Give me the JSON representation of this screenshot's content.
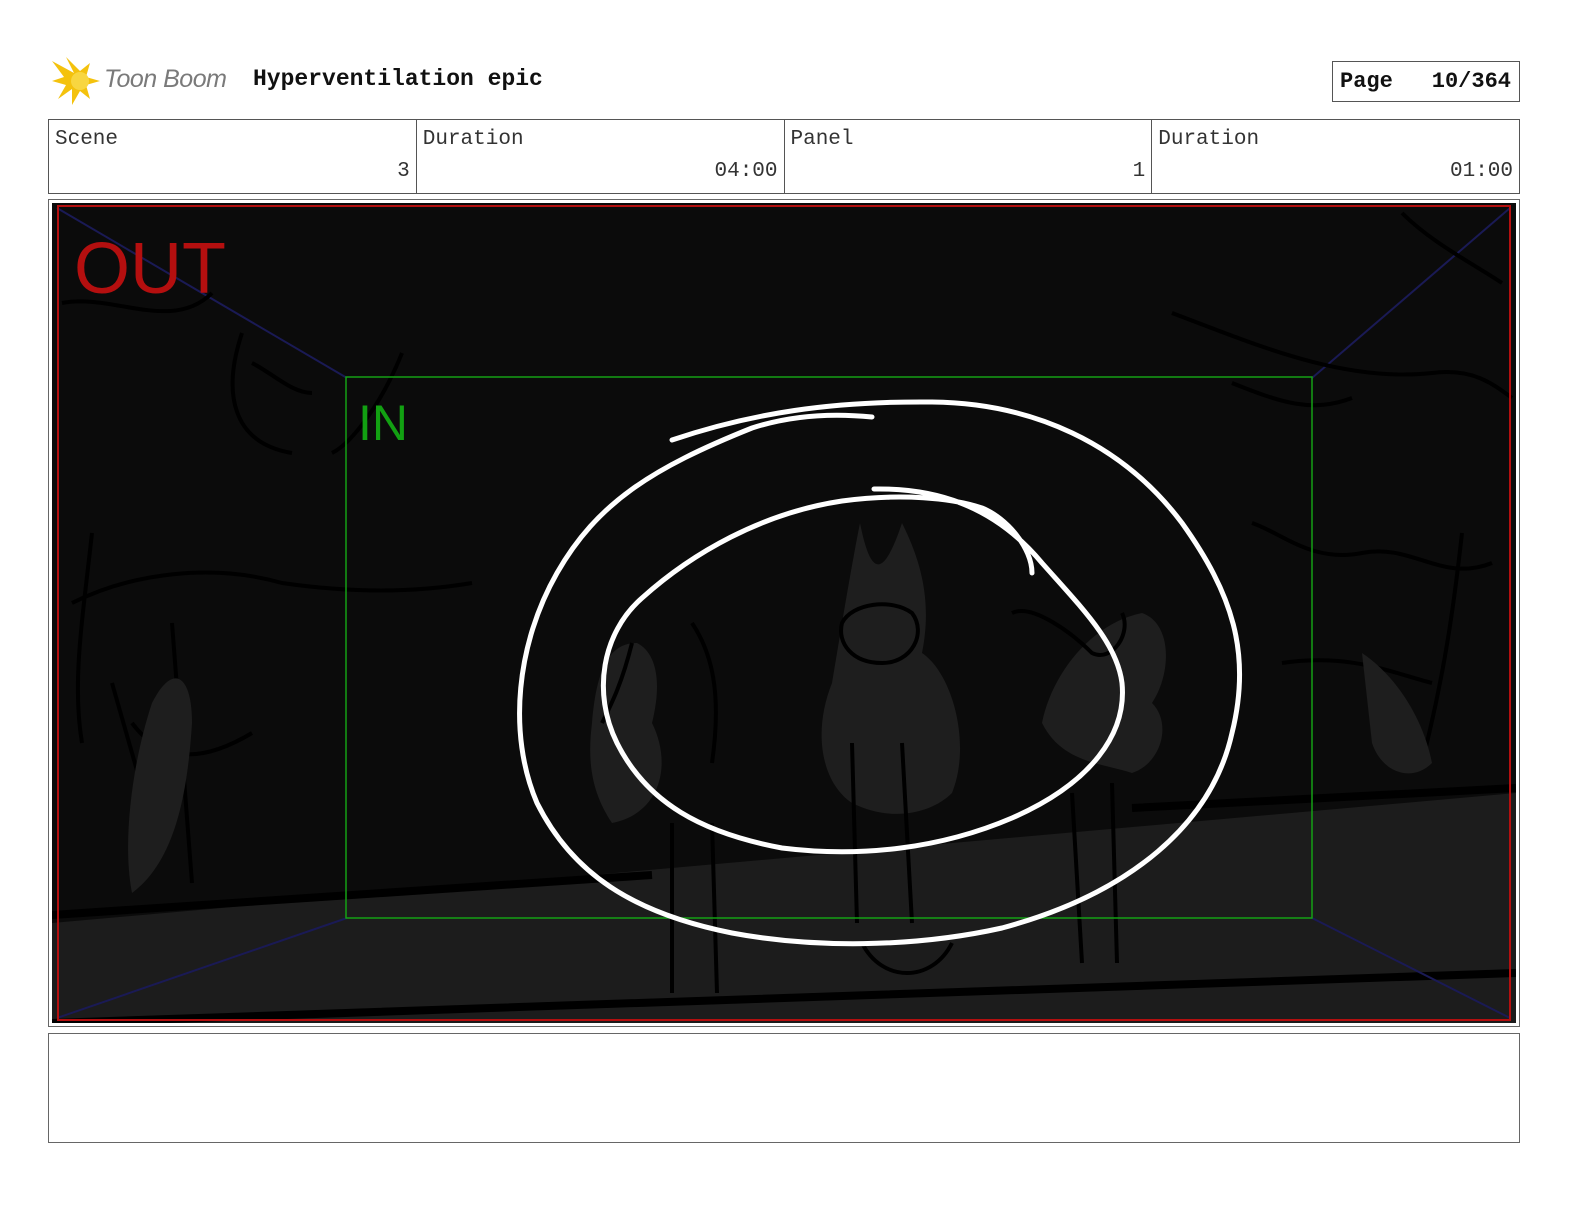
{
  "header": {
    "logo_text": "Toon Boom",
    "project_title": "Hyperventilation epic",
    "page_label": "Page",
    "page_value": "10/364"
  },
  "info": {
    "scene_label": "Scene",
    "scene_value": "3",
    "scene_duration_label": "Duration",
    "scene_duration_value": "04:00",
    "panel_label": "Panel",
    "panel_value": "1",
    "panel_duration_label": "Duration",
    "panel_duration_value": "01:00"
  },
  "panel": {
    "out_label": "OUT",
    "in_label": "IN"
  },
  "notes": {
    "text": ""
  },
  "colors": {
    "out_frame": "#b40f0f",
    "in_frame": "#12a012",
    "panel_background": "#0b0b0b",
    "sketch_lines": "#ffffff"
  }
}
